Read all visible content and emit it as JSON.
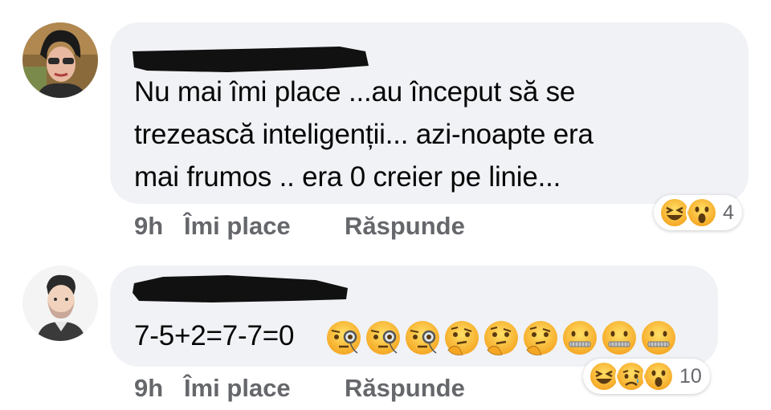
{
  "comments": [
    {
      "avatar_icon": "woman-sunglasses-avatar",
      "text": "Nu mai îmi place ...au început să se\ntrezească inteligenții... azi-noapte era\nmai frumos .. era 0 creier pe linie...",
      "time": "9h",
      "like_label": "Îmi place",
      "reply_label": "Răspunde",
      "reactions": {
        "icons": [
          "laughing-reaction-icon",
          "wow-reaction-icon"
        ],
        "count": "4"
      }
    },
    {
      "avatar_icon": "man-cartoon-avatar",
      "text": "7-5+2=7-7=0",
      "trailing_emojis": [
        "face-with-monocle",
        "face-with-monocle",
        "face-with-monocle",
        "thinking-face",
        "thinking-face",
        "thinking-face",
        "zipper-mouth-face",
        "zipper-mouth-face",
        "zipper-mouth-face"
      ],
      "time": "9h",
      "like_label": "Îmi place",
      "reply_label": "Răspunde",
      "reactions": {
        "icons": [
          "laughing-reaction-icon",
          "sad-reaction-icon",
          "wow-reaction-icon"
        ],
        "count": "10"
      }
    }
  ],
  "colors": {
    "bubble": "#f0f2f5",
    "action_text": "#65676b",
    "text": "#050505",
    "reaction_yellow": "#f7b928"
  }
}
